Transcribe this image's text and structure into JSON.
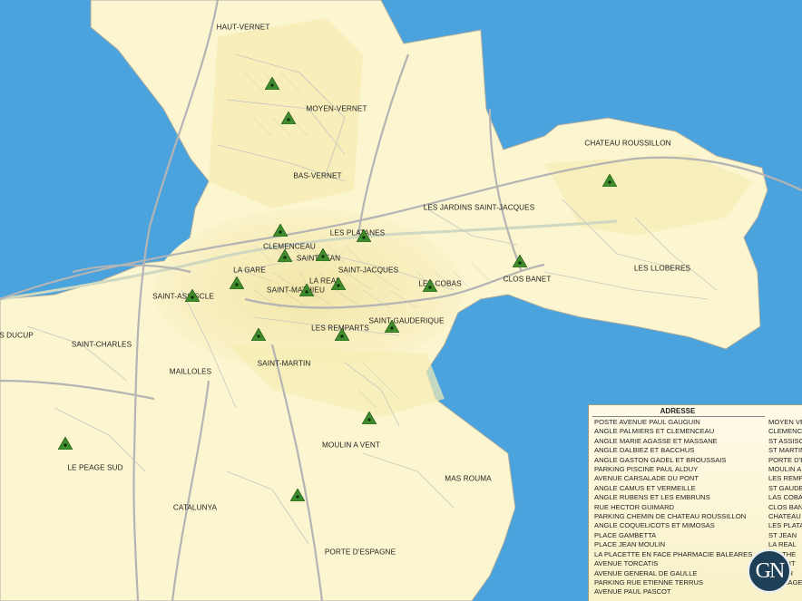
{
  "colors": {
    "sea": "#4aa3dd",
    "land": "#fbf6cf",
    "urban": "#f6ebb0",
    "road": "#b4b4b4",
    "marker_fill": "#3e8c2b",
    "marker_dot": "#0e2a0a",
    "legend_bg": "#fbf6d8",
    "logo_bg": "#1e3f55"
  },
  "districts": [
    {
      "name": "HAUT-VERNET"
    },
    {
      "name": "MOYEN-VERNET"
    },
    {
      "name": "BAS-VERNET"
    },
    {
      "name": "CHATEAU ROUSSILLON"
    },
    {
      "name": "LES JARDINS SAINT-JACQUES"
    },
    {
      "name": "LES PLATANES"
    },
    {
      "name": "CLEMENCEAU"
    },
    {
      "name": "SAINT-JEAN"
    },
    {
      "name": "LA GARE"
    },
    {
      "name": "SAINT-JACQUES"
    },
    {
      "name": "LA REAL"
    },
    {
      "name": "SAINT-ASSISCLE"
    },
    {
      "name": "SAINT-MATHIEU"
    },
    {
      "name": "LES COBAS"
    },
    {
      "name": "CLOS BANET"
    },
    {
      "name": "LES LLOBERES"
    },
    {
      "name": "S DUCUP"
    },
    {
      "name": "SAINT-CHARLES"
    },
    {
      "name": "LES REMPARTS"
    },
    {
      "name": "SAINT-GAUDERIQUE"
    },
    {
      "name": "MAILLOLES"
    },
    {
      "name": "SAINT-MARTIN"
    },
    {
      "name": "MOULIN A VENT"
    },
    {
      "name": "LE PEAGE SUD"
    },
    {
      "name": "MAS ROUMA"
    },
    {
      "name": "CATALUNYA"
    },
    {
      "name": "PORTE D'ESPAGNE"
    }
  ],
  "marker_icon": "green-triangle-marker-icon",
  "legend": {
    "title": "ADRESSE",
    "addresses": [
      "POSTE AVENUE PAUL GAUGUIN",
      "ANGLE PALMIERS ET CLEMENCEAU",
      "ANGLE MARIE AGASSE ET MASSANE",
      "ANGLE DALBIEZ ET BACCHUS",
      "ANGLE GASTON GADEL ET BROUSSAIS",
      "PARKING PISCINE PAUL ALDUY",
      "AVENUE CARSALADE DU PONT",
      "ANGLE CAMUS ET VERMEILLE",
      "ANGLE RUBENS ET LES EMBRUNS",
      "RUE HECTOR GUIMARD",
      "PARKING CHEMIN DE CHATEAU ROUSSILLON",
      "ANGLE COQUELICOTS ET MIMOSAS",
      "PLACE GAMBETTA",
      "PLACE JEAN MOULIN",
      "LA PLACETTE EN FACE PHARMACIE BALEARES",
      "AVENUE TORCATIS",
      "AVENUE GENERAL DE GAULLE",
      "PARKING RUE ETIENNE TERRUS",
      "AVENUE PAUL PASCOT"
    ],
    "quartiers": [
      "MOYEN VE",
      "CLEMENC",
      "ST ASSISC",
      "ST MARTIN",
      "PORTE D'E",
      "MOULIN A",
      "LES REMPA",
      "ST GAUDE",
      "LAS COBA",
      "CLOS BAN",
      "CHATEAU",
      "LES PLATA",
      "ST JEAN",
      "LA REAL",
      "LA ATHE",
      "L ERMIT",
      "",
      "ST VER",
      "LE PEAGE"
    ]
  },
  "logo": {
    "text": "GN"
  }
}
